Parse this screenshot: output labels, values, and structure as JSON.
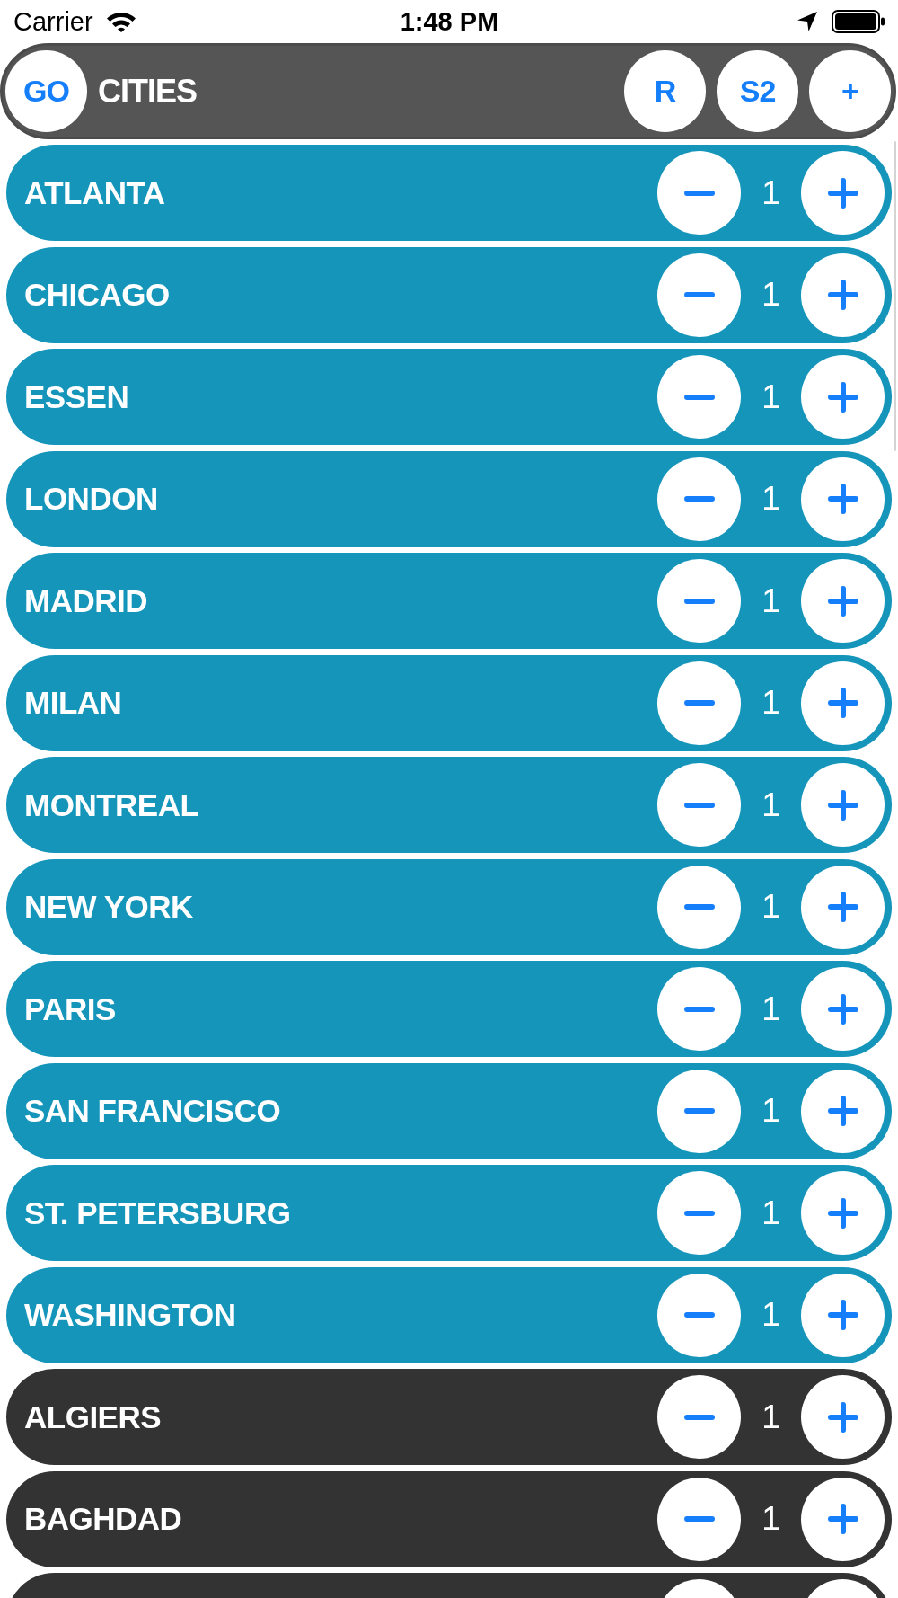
{
  "status_bar": {
    "carrier": "Carrier",
    "time": "1:48 PM"
  },
  "header": {
    "left_button": "GO",
    "title": "CITIES",
    "right_buttons": [
      "R",
      "S2",
      "+"
    ]
  },
  "rows": [
    {
      "name": "ATLANTA",
      "count": "1",
      "color": "#1695bb"
    },
    {
      "name": "CHICAGO",
      "count": "1",
      "color": "#1695bb"
    },
    {
      "name": "ESSEN",
      "count": "1",
      "color": "#1695bb"
    },
    {
      "name": "LONDON",
      "count": "1",
      "color": "#1695bb"
    },
    {
      "name": "MADRID",
      "count": "1",
      "color": "#1695bb"
    },
    {
      "name": "MILAN",
      "count": "1",
      "color": "#1695bb"
    },
    {
      "name": "MONTREAL",
      "count": "1",
      "color": "#1695bb"
    },
    {
      "name": "NEW YORK",
      "count": "1",
      "color": "#1695bb"
    },
    {
      "name": "PARIS",
      "count": "1",
      "color": "#1695bb"
    },
    {
      "name": "SAN FRANCISCO",
      "count": "1",
      "color": "#1695bb"
    },
    {
      "name": "ST. PETERSBURG",
      "count": "1",
      "color": "#1695bb"
    },
    {
      "name": "WASHINGTON",
      "count": "1",
      "color": "#1695bb"
    },
    {
      "name": "ALGIERS",
      "count": "1",
      "color": "#333333"
    },
    {
      "name": "BAGHDAD",
      "count": "1",
      "color": "#333333"
    },
    {
      "color": "#333333"
    }
  ]
}
